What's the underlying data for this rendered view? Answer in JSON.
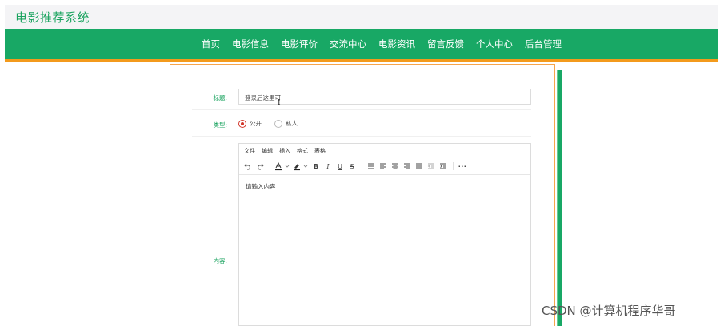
{
  "header": {
    "site_title": "电影推荐系统"
  },
  "nav": {
    "items": [
      "首页",
      "电影信息",
      "电影评价",
      "交流中心",
      "电影资讯",
      "留言反馈",
      "个人中心",
      "后台管理"
    ]
  },
  "form": {
    "title_label": "标题:",
    "title_value": "登录后这里可",
    "type_label": "类型:",
    "type_options": [
      "公开",
      "私人"
    ],
    "type_selected": "公开",
    "content_label": "内容:"
  },
  "editor": {
    "menu": [
      "文件",
      "编辑",
      "插入",
      "格式",
      "表格"
    ],
    "placeholder": "请输入内容",
    "toolbar_icons": [
      "undo-icon",
      "redo-icon",
      "text-color-icon",
      "highlight-icon",
      "bold-icon",
      "italic-icon",
      "underline-icon",
      "strikethrough-icon",
      "bullet-list-icon",
      "align-left-icon",
      "align-center-icon",
      "align-right-icon",
      "align-justify-icon",
      "outdent-icon",
      "indent-icon",
      "more-icon"
    ]
  },
  "watermark": "CSDN @计算机程序华哥",
  "colors": {
    "brand_green": "#18a865",
    "accent_orange": "#f39a1c",
    "radio_red": "#d2362a"
  }
}
